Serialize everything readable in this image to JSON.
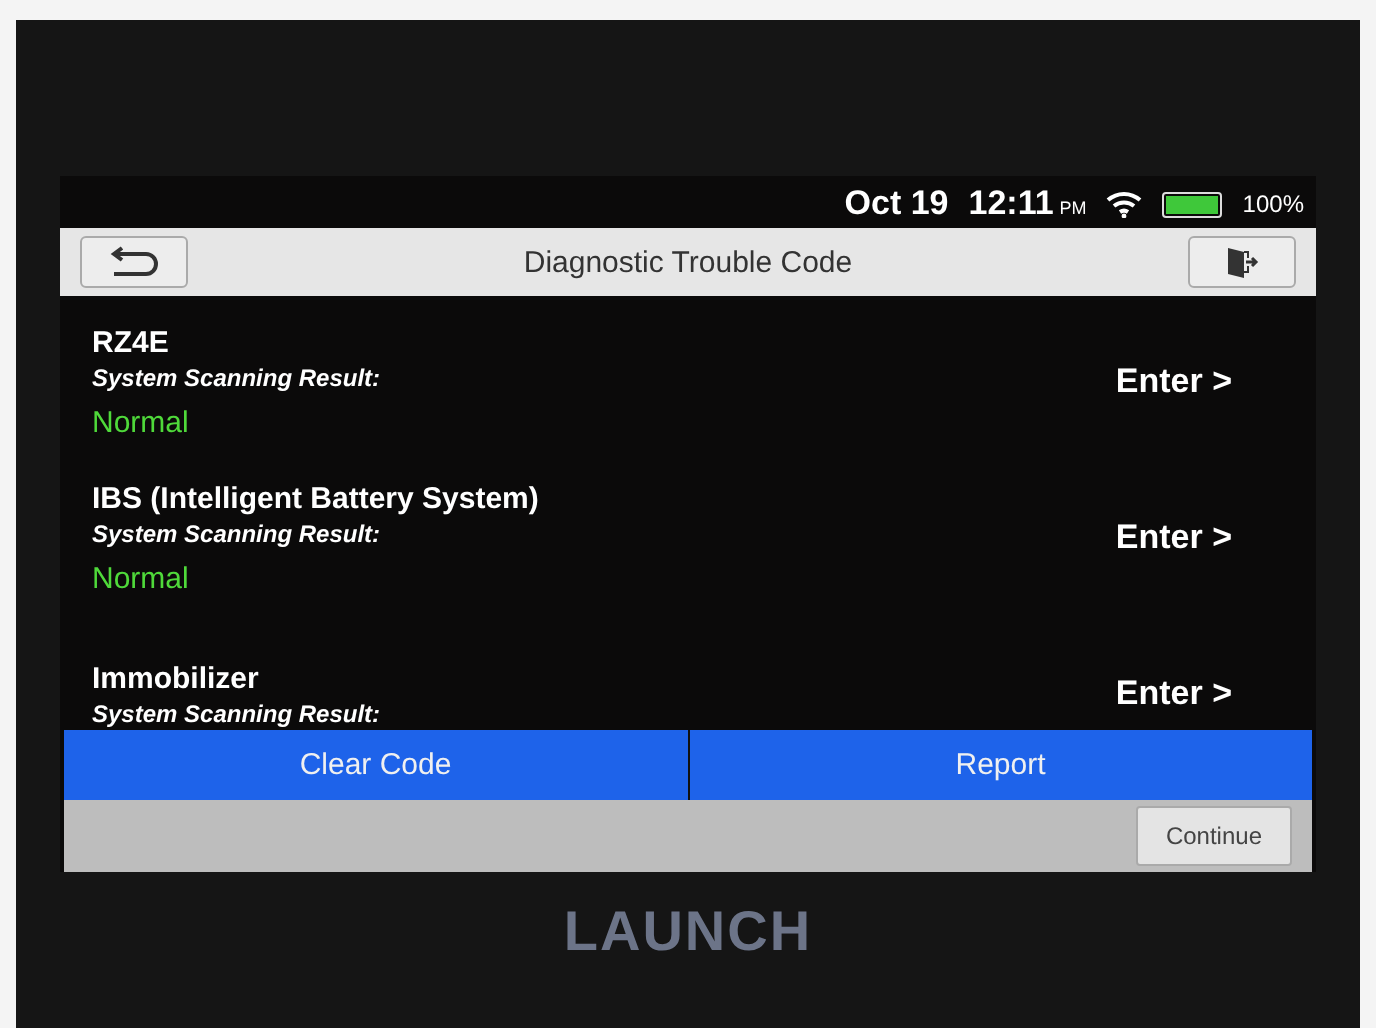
{
  "status_bar": {
    "date": "Oct 19",
    "time": "12:11",
    "ampm": "PM",
    "battery": "100%"
  },
  "header": {
    "title": "Diagnostic Trouble Code"
  },
  "systems": [
    {
      "name": "RZ4E",
      "label": "System Scanning Result:",
      "result": "Normal",
      "action": "Enter >"
    },
    {
      "name": "IBS (Intelligent Battery System)",
      "label": "System Scanning Result:",
      "result": "Normal",
      "action": "Enter >"
    },
    {
      "name": "Immobilizer",
      "label": "System Scanning Result:",
      "action": "Enter >"
    }
  ],
  "buttons": [
    "Clear Code",
    "Report"
  ],
  "footer": {
    "continue": "Continue"
  },
  "bezel": {
    "brand": "LAUNCH"
  }
}
